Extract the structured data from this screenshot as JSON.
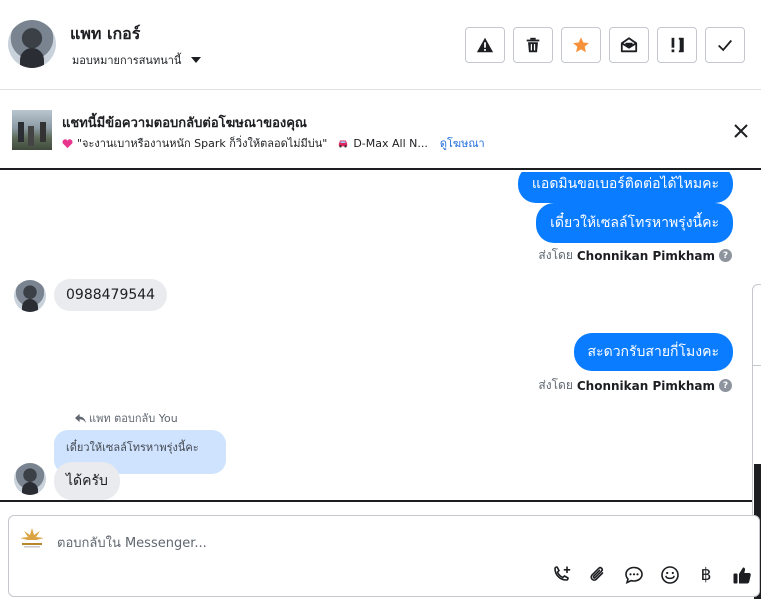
{
  "header": {
    "user_name": "แพท เกอร์",
    "assign_label": "มอบหมายการสนทนานี้",
    "buttons": [
      {
        "name": "spam-button",
        "icon": "warning-icon"
      },
      {
        "name": "delete-button",
        "icon": "trash-icon"
      },
      {
        "name": "star-button",
        "icon": "star-icon",
        "color": "#f7923a"
      },
      {
        "name": "mark-unread-button",
        "icon": "envelope-open-icon"
      },
      {
        "name": "follow-up-button",
        "icon": "exclamation-icon"
      },
      {
        "name": "mark-done-button",
        "icon": "checkmark-icon"
      }
    ]
  },
  "ad_banner": {
    "title": "แชทนี้มีข้อความตอบกลับต่อโฆษณาของคุณ",
    "text": "\"จะงานเบาหรืองานหนัก Spark ก็วิ่งให้ตลอดไม่มีบ่น\"",
    "product": "D-Max All N...",
    "link": "ดูโฆษณา"
  },
  "messages": {
    "out_1": "แอดมินขอเบอร์ติดต่อได้ไหมคะ",
    "out_2": "เดี๋ยวให้เซลล์โทรหาพรุ่งนี้คะ",
    "sent_by_prefix": "ส่งโดย",
    "sent_by_name": "Chonnikan Pimkham",
    "help_mark": "?",
    "in_1": "0988479544",
    "out_3": "สะดวกรับสายกี่โมงคะ",
    "reply_note": "แพท ตอบกลับ You",
    "quoted": "เดี๋ยวให้เซลล์โทรหาพรุ่งนี้คะ",
    "in_2": "ได้ครับ"
  },
  "composer": {
    "placeholder": "ตอบกลับใน Messenger...",
    "tools": [
      "call-plus-icon",
      "attachment-icon",
      "comment-icon",
      "emoji-icon",
      "baht-icon",
      "thumbs-up-icon"
    ],
    "baht_symbol": "฿"
  },
  "colors": {
    "accent_blue": "#0a7cff",
    "bubble_gray": "#e9ebee",
    "quote_blue": "#cfe3ff",
    "link_blue": "#216fdb",
    "star_orange": "#f7923a"
  }
}
